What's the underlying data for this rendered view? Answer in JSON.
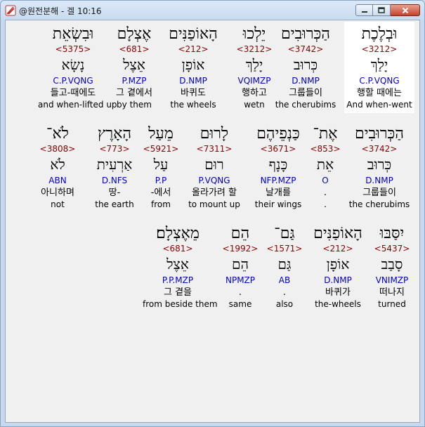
{
  "window": {
    "title": "@원전분해 - 겔 10:16"
  },
  "rows": [
    {
      "words": [
        {
          "hebrew": "וּבְלֶכֶת",
          "strong": "<3212>",
          "lemma": "יָלַךְ",
          "parse": "C.P.VQNG",
          "korean": "행할 때에는",
          "english": "And when-went",
          "highlighted": true
        },
        {
          "hebrew": "הַכְּרוּבִים",
          "strong": "<3742>",
          "lemma": "כְּרוּב",
          "parse": "D.NMP",
          "korean": "그룹들이",
          "english": "the cherubims",
          "highlighted": false
        },
        {
          "hebrew": "יֵלְכוּ",
          "strong": "<3212>",
          "lemma": "יָלַךְ",
          "parse": "VQIMZP",
          "korean": "행하고",
          "english": "wetn",
          "highlighted": false
        },
        {
          "hebrew": "הָאוֹפַנִּים",
          "strong": "<212>",
          "lemma": "אוֹפָן",
          "parse": "D.NMP",
          "korean": "바퀴도",
          "english": "the wheels",
          "highlighted": false
        },
        {
          "hebrew": "אֶצְלָם",
          "strong": "<681>",
          "lemma": "אֵצֶל",
          "parse": "P.MZP",
          "korean": "그 곁에서",
          "english": "by them",
          "highlighted": false
        },
        {
          "hebrew": "וּבִשְׂאֵת",
          "strong": "<5375>",
          "lemma": "נָשָׂא",
          "parse": "C.P.VQNG",
          "korean": "들고-때에도",
          "english": "and when-lifted up",
          "highlighted": false
        }
      ]
    },
    {
      "words": [
        {
          "hebrew": "הַכְּרוּבִים",
          "strong": "<3742>",
          "lemma": "כְּרוּב",
          "parse": "D.NMP",
          "korean": "그룹들이",
          "english": "the cherubims",
          "highlighted": false
        },
        {
          "hebrew": "אֶת־",
          "strong": "<853>",
          "lemma": "אֵת",
          "parse": "O",
          "korean": ".",
          "english": ".",
          "highlighted": false
        },
        {
          "hebrew": "כַּנְפֵיהֶם",
          "strong": "<3671>",
          "lemma": "כָּנָף",
          "parse": "NFP.MZP",
          "korean": "날개를",
          "english": "their wings",
          "highlighted": false
        },
        {
          "hebrew": "לָרוּם",
          "strong": "<7311>",
          "lemma": "רוּם",
          "parse": "P.VQNG",
          "korean": "올라가려 할",
          "english": "to mount up",
          "highlighted": false
        },
        {
          "hebrew": "מֵעַל",
          "strong": "<5921>",
          "lemma": "עַל",
          "parse": "P.P",
          "korean": "-에서",
          "english": "from",
          "highlighted": false
        },
        {
          "hebrew": "הָאָרֶץ",
          "strong": "<773>",
          "lemma": "אַרְעִית",
          "parse": "D.NFS",
          "korean": "땅-",
          "english": "the earth",
          "highlighted": false
        },
        {
          "hebrew": "לֹא־",
          "strong": "<3808>",
          "lemma": "לֹא",
          "parse": "ABN",
          "korean": "아니하며",
          "english": "not",
          "highlighted": false
        }
      ]
    },
    {
      "words": [
        {
          "hebrew": "יִסַּבּוּ",
          "strong": "<5437>",
          "lemma": "סָבַב",
          "parse": "VNIMZP",
          "korean": "떠나지",
          "english": "turned",
          "highlighted": false
        },
        {
          "hebrew": "הָאוֹפַנִּים",
          "strong": "<212>",
          "lemma": "אוֹפָן",
          "parse": "D.NMP",
          "korean": "바퀴가",
          "english": "the-wheels",
          "highlighted": false
        },
        {
          "hebrew": "גַּם־",
          "strong": "<1571>",
          "lemma": "גַּם",
          "parse": "AB",
          "korean": ".",
          "english": "also",
          "highlighted": false
        },
        {
          "hebrew": "הֵם",
          "strong": "<1992>",
          "lemma": "הֵם",
          "parse": "NPMZP",
          "korean": ".",
          "english": "same",
          "highlighted": false
        },
        {
          "hebrew": "מֵאֶצְלָם׃",
          "strong": "<681>",
          "lemma": "אֵצֶל",
          "parse": "P.P.MZP",
          "korean": "그 곁을",
          "english": "from beside them",
          "highlighted": false
        }
      ]
    }
  ],
  "colors": {
    "strong": "#8b0000",
    "parse": "#0000c8",
    "highlight": "#ffffff",
    "background": "#f0f0f0"
  },
  "icons": [
    "app-icon",
    "minimize-icon",
    "maximize-icon",
    "close-icon"
  ]
}
